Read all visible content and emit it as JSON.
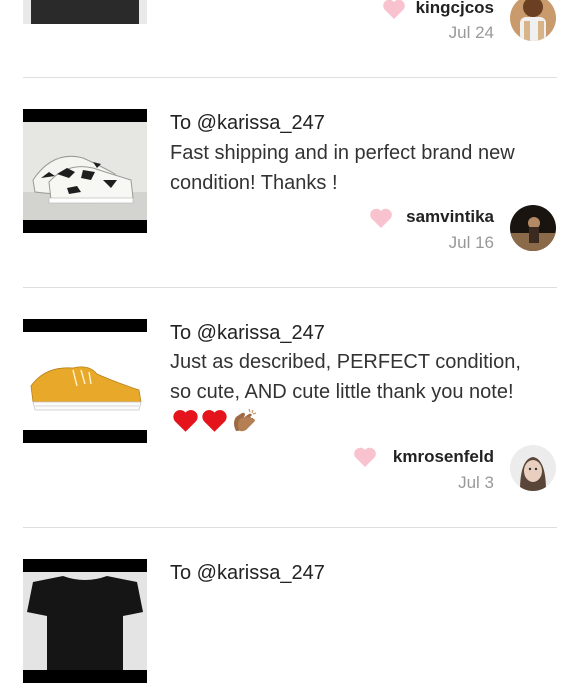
{
  "reviews": [
    {
      "to": "",
      "text": "",
      "username": "kingcjcos",
      "date": "Jul 24"
    },
    {
      "to": "To @karissa_247",
      "text": "Fast shipping and in perfect brand new condition! Thanks !",
      "username": "samvintika",
      "date": "Jul 16"
    },
    {
      "to": "To @karissa_247",
      "text": "Just as described, PERFECT condition, so cute, AND cute little thank you note!",
      "emojis": [
        "heart-red-icon",
        "heart-red-icon",
        "clapping-hands-icon"
      ],
      "username": "kmrosenfeld",
      "date": "Jul 3"
    },
    {
      "to": "To @karissa_247",
      "text": "",
      "username": "",
      "date": ""
    }
  ],
  "colors": {
    "like_heart": "#f8c3cf",
    "date_gray": "#999999",
    "divider": "#dedede",
    "mustard_shoe": "#e8a92a"
  }
}
